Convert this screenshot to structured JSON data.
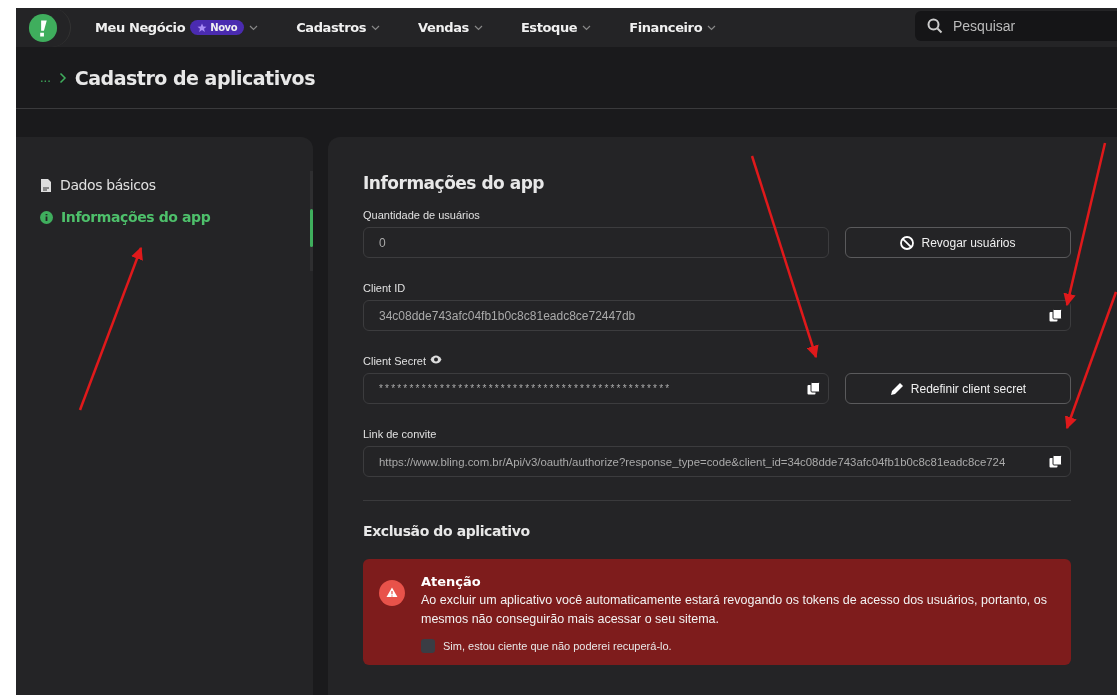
{
  "navbar": {
    "items": [
      {
        "label": "Meu Negócio",
        "badge": "Novo"
      },
      {
        "label": "Cadastros"
      },
      {
        "label": "Vendas"
      },
      {
        "label": "Estoque"
      },
      {
        "label": "Financeiro"
      }
    ],
    "search": {
      "placeholder": "Pesquisar"
    }
  },
  "header": {
    "breadcrumb": "...",
    "title": "Cadastro de aplicativos"
  },
  "sidebar": {
    "items": [
      {
        "label": "Dados básicos",
        "kind": "document",
        "selected": false
      },
      {
        "label": "Informações do app",
        "kind": "info",
        "selected": true
      }
    ]
  },
  "panel": {
    "title": "Informações do app",
    "users": {
      "label": "Quantidade de usuários",
      "value": "0",
      "button": "Revogar usuários"
    },
    "client_id": {
      "label": "Client ID",
      "value": "34c08dde743afc04fb1b0c8c81eadc8ce72447db"
    },
    "client_secret": {
      "label": "Client Secret",
      "value": "************************************************",
      "button": "Redefinir client secret"
    },
    "invite_link": {
      "label": "Link de convite",
      "value": "https://www.bling.com.br/Api/v3/oauth/authorize?response_type=code&client_id=34c08dde743afc04fb1b0c8c81eadc8ce724"
    },
    "deletion": {
      "title": "Exclusão do aplicativo",
      "alert_title": "Atenção",
      "alert_text": "Ao excluir um aplicativo você automaticamente estará revogando os tokens de acesso dos usuários, portanto, os mesmos não conseguirão mais acessar o seu sitema.",
      "confirm": {
        "label": "Sim, estou ciente que não poderei recuperá-lo.",
        "checked": false
      }
    }
  }
}
